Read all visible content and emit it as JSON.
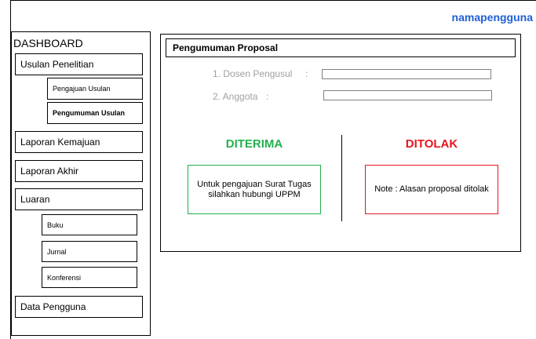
{
  "header": {
    "username": "namapengguna"
  },
  "sidebar": {
    "title": "DASHBOARD",
    "items": {
      "usulan_penelitian": "Usulan Penelitian",
      "pengajuan_usulan": "Pengajuan Usulan",
      "pengumuman_usulan": "Pengumuman Usulan",
      "laporan_kemajuan": "Laporan Kemajuan",
      "laporan_akhir": "Laporan Akhir",
      "luaran": "Luaran",
      "buku": "Buku",
      "jurnal": "Jurnal",
      "konferensi": "Konferensi",
      "data_pengguna": "Data Pengguna"
    }
  },
  "main": {
    "title": "Pengumuman Proposal",
    "fields": {
      "dosen_label": "1. Dosen Pengusul",
      "dosen_sep": ":",
      "dosen_value": "",
      "anggota_label": "2. Anggota",
      "anggota_sep": ":",
      "anggota_value": ""
    },
    "accepted": {
      "label": "DITERIMA",
      "message": "Untuk pengajuan Surat Tugas silahkan hubungi UPPM",
      "color": "#22b14c"
    },
    "rejected": {
      "label": "DITOLAK",
      "message": "Note : Alasan proposal ditolak",
      "color": "#e8141e"
    }
  }
}
